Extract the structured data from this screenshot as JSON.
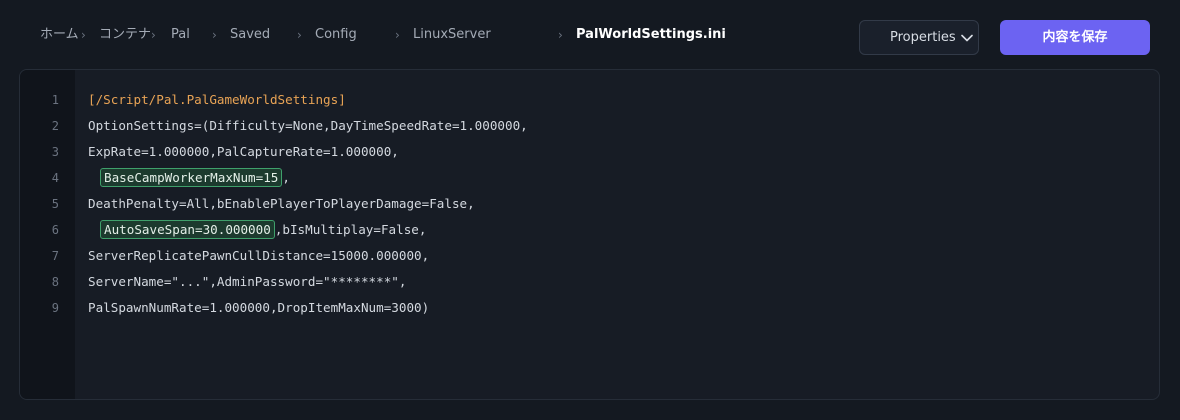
{
  "breadcrumb": {
    "items": [
      "ホーム",
      "コンテナ",
      "Pal",
      "Saved",
      "Config",
      "LinuxServer"
    ],
    "current": "PalWorldSettings.ini",
    "separator": "›"
  },
  "toolbar": {
    "properties_label": "Properties",
    "save_label": "内容を保存"
  },
  "editor": {
    "line_numbers": [
      "1",
      "2",
      "3",
      "4",
      "5",
      "6",
      "7",
      "8",
      "9"
    ],
    "lines": {
      "l1": "[/Script/Pal.PalGameWorldSettings]",
      "l2": "OptionSettings=(Difficulty=None,DayTimeSpeedRate=1.000000,",
      "l3": "ExpRate=1.000000,PalCaptureRate=1.000000,",
      "l4_highlight": "BaseCampWorkerMaxNum=15",
      "l4_rest": ",",
      "l5": "DeathPenalty=All,bEnablePlayerToPlayerDamage=False,",
      "l6_highlight": "AutoSaveSpan=30.000000",
      "l6_rest": ",bIsMultiplay=False,",
      "l7": "ServerReplicatePawnCullDistance=15000.000000,",
      "l8": "ServerName=\"...\",AdminPassword=\"********\",",
      "l9": "PalSpawnNumRate=1.000000,DropItemMaxNum=3000)"
    }
  },
  "colors": {
    "background": "#141921",
    "accent": "#6c63f2",
    "section_header": "#e8a355",
    "highlight_border": "#3fa06b"
  },
  "icons": {
    "separator": "chevron-right-icon",
    "dropdown": "chevron-down-icon"
  }
}
